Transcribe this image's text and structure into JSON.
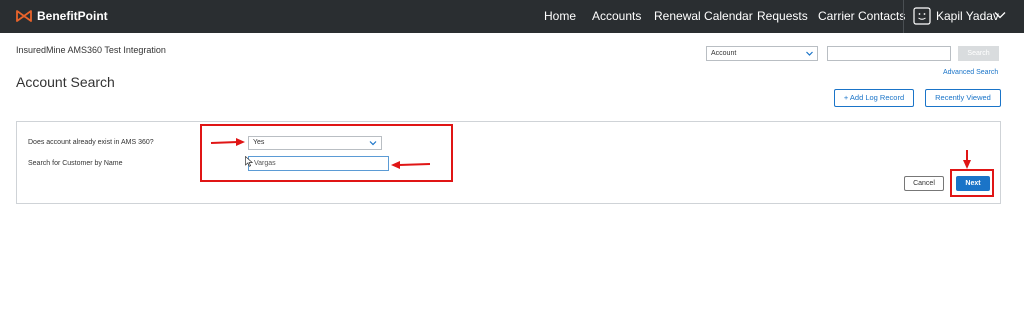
{
  "app": {
    "name": "BenefitPoint"
  },
  "nav": {
    "items": [
      {
        "label": "Home"
      },
      {
        "label": "Accounts"
      },
      {
        "label": "Renewal Calendar"
      },
      {
        "label": "Requests"
      },
      {
        "label": "Carrier Contacts"
      }
    ],
    "user": "Kapil Yadav"
  },
  "header": {
    "tenant": "InsuredMine AMS360 Test Integration",
    "title": "Account Search"
  },
  "search": {
    "scope_value": "Account",
    "query_value": "",
    "button_label": "Search",
    "advanced_label": "Advanced Search"
  },
  "actions": {
    "add_log_label": "+ Add Log Record",
    "recently_viewed_label": "Recently Viewed"
  },
  "form": {
    "exists_label": "Does account already exist in AMS 360?",
    "exists_value": "Yes",
    "name_label": "Search for Customer by Name",
    "name_value": "Vargas",
    "cancel_label": "Cancel",
    "next_label": "Next"
  },
  "colors": {
    "topbar": "#2a2e31",
    "accent": "#1a74c8",
    "brand_orange": "#e8632b",
    "annotation_red": "#e01515"
  }
}
